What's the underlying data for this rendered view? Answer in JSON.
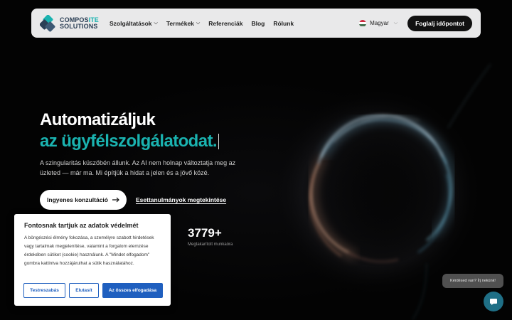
{
  "brand": {
    "line1_main": "COMPOS",
    "line1_accent": "ITE",
    "line2": "SOLUTIONS"
  },
  "nav": {
    "items": [
      {
        "label": "Szolgáltatások",
        "has_dropdown": true
      },
      {
        "label": "Termékek",
        "has_dropdown": true
      },
      {
        "label": "Referenciák",
        "has_dropdown": false
      },
      {
        "label": "Blog",
        "has_dropdown": false
      },
      {
        "label": "Rólunk",
        "has_dropdown": false
      }
    ],
    "language": "Magyar",
    "cta": "Foglalj időpontot"
  },
  "hero": {
    "title_line1": "Automatizáljuk",
    "title_line2": "az ügyfélszolgálatodat.",
    "subtitle": "A szingularitás küszöbén állunk. Az AI nem holnap változtatja meg az üzleted — már ma. Mi építjük a hidat a jelen és a jövő közé.",
    "primary_button": "Ingyenes konzultáció",
    "secondary_link": "Esettanulmányok megtekintése",
    "stat_value": "3779+",
    "stat_label": "Megtakarított munkaóra"
  },
  "cookie": {
    "title": "Fontosnak tartjuk az adatok védelmét",
    "text": "A böngészési élmény fokozása, a személyre szabott hirdetések vagy tartalmak megjelenítése, valamint a forgalom elemzése érdekében sütiket (cookie) használunk. A \"Mindet elfogadom\" gombra kattintva hozzájárulhat a sütik használatához.",
    "customize": "Testreszabás",
    "reject": "Elutasít",
    "accept_all": "Az összes elfogadása"
  },
  "chat": {
    "bubble": "Kérdésed van? Írj nekünk!"
  },
  "colors": {
    "accent_teal": "#1ab3b0",
    "cookie_blue": "#1f5fbf",
    "nav_bg": "#e9e9ea",
    "chat_btn": "#1f6f86"
  },
  "icons": [
    "logo-mark-icon",
    "chevron-down-icon",
    "hungary-flag-icon",
    "arrow-right-icon",
    "chat-icon"
  ]
}
